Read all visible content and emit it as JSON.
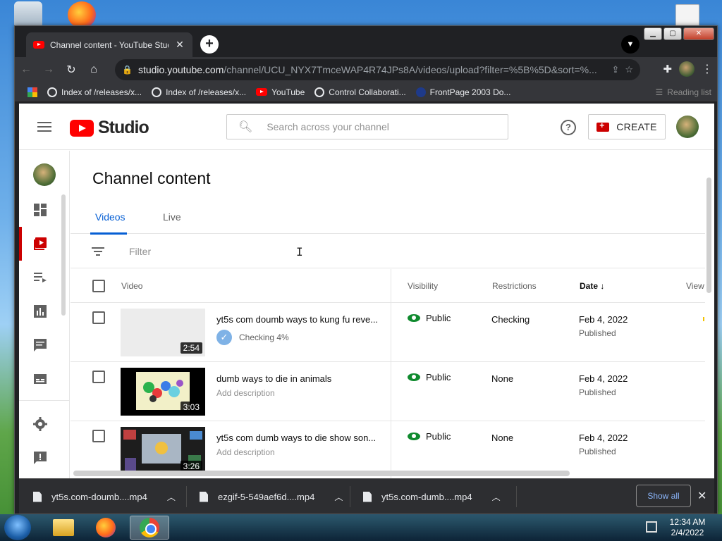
{
  "browser": {
    "tab_title": "Channel content - YouTube Studio",
    "url_host": "studio.youtube.com",
    "url_path": "/channel/UCU_NYX7TmceWAP4R74JPs8A/videos/upload?filter=%5B%5D&sort=%...",
    "bookmarks": [
      "Index of /releases/x...",
      "Index of /releases/x...",
      "YouTube",
      "Control Collaborati...",
      "FrontPage 2003 Do..."
    ],
    "reading_list": "Reading list"
  },
  "studio": {
    "logo_text": "Studio",
    "search_placeholder": "Search across your channel",
    "create_label": "CREATE",
    "page_title": "Channel content",
    "tabs": [
      "Videos",
      "Live"
    ],
    "filter_placeholder": "Filter",
    "columns": {
      "video": "Video",
      "visibility": "Visibility",
      "restrictions": "Restrictions",
      "date": "Date",
      "views": "View"
    },
    "rows": [
      {
        "title": "yt5s com doumb ways to kung fu reve...",
        "duration": "2:54",
        "status": "Checking 4%",
        "visibility": "Public",
        "restrictions": "Checking",
        "date": "Feb 4, 2022",
        "date_status": "Published"
      },
      {
        "title": "dumb ways to die in animals",
        "duration": "3:03",
        "description": "Add description",
        "visibility": "Public",
        "restrictions": "None",
        "date": "Feb 4, 2022",
        "date_status": "Published"
      },
      {
        "title": "yt5s com dumb ways to die show son...",
        "duration": "3:26",
        "description": "Add description",
        "visibility": "Public",
        "restrictions": "None",
        "date": "Feb 4, 2022",
        "date_status": "Published"
      }
    ]
  },
  "downloads": {
    "items": [
      "yt5s.com-doumb....mp4",
      "ezgif-5-549aef6d....mp4",
      "yt5s.com-dumb....mp4"
    ],
    "show_all": "Show all"
  },
  "taskbar": {
    "time": "12:34 AM",
    "date": "2/4/2022"
  },
  "colors": {
    "accent_blue": "#065fd4",
    "youtube_red": "#ff0000",
    "public_green": "#0f8a2e"
  }
}
